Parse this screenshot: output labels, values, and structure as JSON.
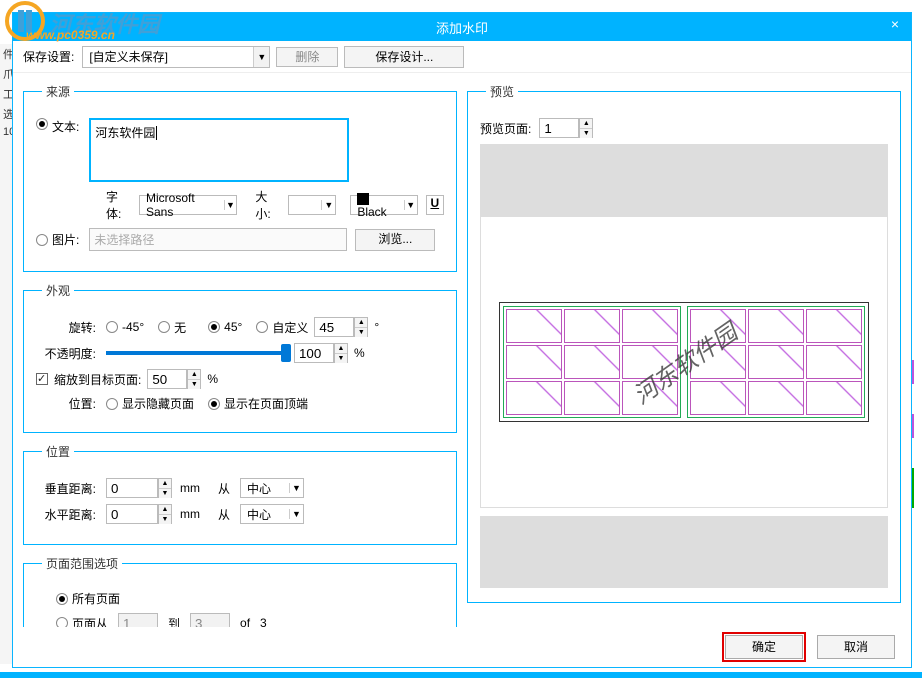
{
  "window": {
    "title": "添加水印",
    "close": "×"
  },
  "left_strip": [
    "件",
    "爪",
    "工",
    "选",
    "10"
  ],
  "logo": {
    "brand": "河东软件园",
    "url": "www.pc0359.cn"
  },
  "toolbar": {
    "save_settings_label": "保存设置:",
    "preset_value": "[自定义未保存]",
    "delete_label": "删除",
    "save_design_label": "保存设计..."
  },
  "source": {
    "legend": "来源",
    "text_radio": "文本:",
    "text_value": "河东软件园",
    "font_label": "字体:",
    "font_value": "Microsoft Sans",
    "size_label": "大小:",
    "size_value": "",
    "color_label": "Black",
    "underline": "U",
    "image_radio": "图片:",
    "image_path_placeholder": "未选择路径",
    "browse_label": "浏览..."
  },
  "appearance": {
    "legend": "外观",
    "rotate_label": "旋转:",
    "rot_neg45": "-45°",
    "rot_none": "无",
    "rot_45": "45°",
    "rot_custom": "自定义",
    "rot_custom_value": "45",
    "degree": "°",
    "opacity_label": "不透明度:",
    "opacity_value": "100",
    "percent": "%",
    "scale_check": "缩放到目标页面:",
    "scale_value": "50",
    "position_label": "位置:",
    "pos_hidden": "显示隐藏页面",
    "pos_top": "显示在页面顶端"
  },
  "position": {
    "legend": "位置",
    "vert_label": "垂直距离:",
    "vert_value": "0",
    "horz_label": "水平距离:",
    "horz_value": "0",
    "unit": "mm",
    "from_label": "从",
    "from_value": "中心"
  },
  "range": {
    "legend": "页面范围选项",
    "all_pages": "所有页面",
    "pages_from": "页面从",
    "from_value": "1",
    "to_label": "到",
    "to_value": "3",
    "of_label": "of",
    "total": "3"
  },
  "preview": {
    "legend": "预览",
    "page_label": "预览页面:",
    "page_value": "1",
    "watermark_text": "河东软件园"
  },
  "footer": {
    "ok": "确定",
    "cancel": "取消"
  }
}
